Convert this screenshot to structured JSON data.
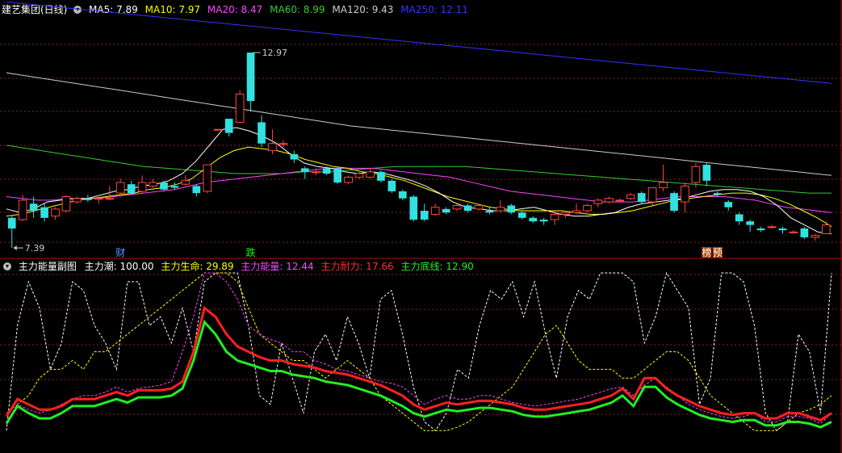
{
  "colors": {
    "up": "#ff4444",
    "down": "#33e0e0",
    "ma5": "#ffffff",
    "ma10": "#ffff00",
    "ma20": "#ff44ff",
    "ma60": "#33cc33",
    "ma120": "#cccccc",
    "ma250": "#3333ff"
  },
  "main_header": {
    "title": "建艺集团(日线)",
    "ma5": "MA5: 7.89",
    "ma10": "MA10: 7.97",
    "ma20": "MA20: 8.47",
    "ma60": "MA60: 8.99",
    "ma120": "MA120: 9.43",
    "ma250": "MA250: 12.11"
  },
  "sub_header": {
    "title": "主力能量副图",
    "l1": "主力潮: 100.00",
    "l2": "主力生命: 29.89",
    "l3": "主力能量: 12.44",
    "l4": "主力耐力: 17.66",
    "l5": "主力底线: 12.90"
  },
  "chart_data": [
    {
      "type": "candlestick",
      "title": "建艺集团(日线)",
      "ylim": [
        7.2,
        14.0
      ],
      "high_label": "12.97",
      "low_label": "7.39",
      "candles": [
        [
          8.3,
          8.0,
          8.35,
          7.45
        ],
        [
          8.25,
          8.8,
          8.95,
          8.2
        ],
        [
          8.7,
          8.5,
          8.9,
          8.3
        ],
        [
          8.6,
          8.3,
          8.7,
          8.2
        ],
        [
          8.35,
          8.55,
          8.6,
          8.25
        ],
        [
          8.5,
          8.9,
          8.95,
          8.45
        ],
        [
          8.75,
          8.85,
          8.9,
          8.7
        ],
        [
          8.85,
          8.8,
          8.95,
          8.75
        ],
        [
          8.85,
          8.85,
          8.9,
          8.7
        ],
        [
          8.85,
          8.85,
          9.2,
          8.8
        ],
        [
          9.0,
          9.3,
          9.4,
          8.9
        ],
        [
          9.25,
          9.0,
          9.35,
          8.95
        ],
        [
          9.05,
          9.3,
          9.5,
          9.0
        ],
        [
          9.2,
          9.3,
          9.4,
          9.15
        ],
        [
          9.3,
          9.1,
          9.35,
          9.05
        ],
        [
          9.2,
          9.15,
          9.3,
          9.1
        ],
        [
          9.25,
          9.35,
          9.5,
          9.2
        ],
        [
          9.2,
          9.0,
          9.25,
          8.9
        ],
        [
          9.05,
          9.8,
          9.8,
          9.0
        ],
        [
          10.8,
          10.8,
          10.8,
          10.8
        ],
        [
          11.1,
          10.7,
          11.1,
          10.6
        ],
        [
          11.0,
          11.8,
          11.9,
          11.0
        ],
        [
          12.97,
          11.6,
          12.97,
          11.3
        ],
        [
          11.0,
          10.4,
          11.2,
          10.3
        ],
        [
          10.2,
          10.4,
          10.8,
          10.1
        ],
        [
          10.4,
          10.4,
          10.5,
          10.3
        ],
        [
          10.1,
          9.95,
          10.2,
          9.85
        ],
        [
          9.7,
          9.6,
          9.75,
          9.4
        ],
        [
          9.6,
          9.6,
          9.7,
          9.5
        ],
        [
          9.7,
          9.55,
          9.75,
          9.5
        ],
        [
          9.7,
          9.3,
          9.75,
          9.25
        ],
        [
          9.3,
          9.45,
          9.5,
          9.25
        ],
        [
          9.45,
          9.55,
          9.6,
          9.4
        ],
        [
          9.45,
          9.6,
          9.7,
          9.4
        ],
        [
          9.6,
          9.35,
          9.65,
          9.3
        ],
        [
          9.35,
          9.05,
          9.4,
          9.0
        ],
        [
          9.05,
          8.85,
          9.1,
          8.8
        ],
        [
          8.9,
          8.25,
          8.95,
          8.2
        ],
        [
          8.5,
          8.25,
          8.7,
          8.2
        ],
        [
          8.4,
          8.6,
          8.7,
          8.35
        ],
        [
          8.55,
          8.45,
          8.6,
          8.4
        ],
        [
          8.55,
          8.65,
          8.7,
          8.5
        ],
        [
          8.65,
          8.5,
          8.7,
          8.45
        ],
        [
          8.55,
          8.65,
          8.7,
          8.5
        ],
        [
          8.5,
          8.45,
          8.6,
          8.4
        ],
        [
          8.5,
          8.6,
          8.8,
          8.45
        ],
        [
          8.65,
          8.45,
          8.7,
          8.4
        ],
        [
          8.45,
          8.3,
          8.5,
          8.25
        ],
        [
          8.3,
          8.2,
          8.35,
          8.15
        ],
        [
          8.25,
          8.2,
          8.3,
          8.1
        ],
        [
          8.25,
          8.4,
          8.5,
          8.1
        ],
        [
          8.4,
          8.45,
          8.5,
          8.3
        ],
        [
          8.45,
          8.5,
          8.7,
          8.4
        ],
        [
          8.5,
          8.65,
          8.7,
          8.45
        ],
        [
          8.7,
          8.8,
          8.85,
          8.6
        ],
        [
          8.75,
          8.85,
          8.9,
          8.7
        ],
        [
          8.8,
          8.8,
          8.85,
          8.75
        ],
        [
          8.85,
          8.95,
          9.0,
          8.8
        ],
        [
          9.0,
          8.75,
          9.05,
          8.7
        ],
        [
          8.75,
          9.15,
          9.15,
          8.65
        ],
        [
          9.15,
          9.3,
          9.8,
          9.05
        ],
        [
          9.0,
          8.5,
          9.05,
          8.45
        ],
        [
          8.75,
          9.2,
          9.3,
          8.45
        ],
        [
          9.3,
          9.75,
          9.85,
          9.15
        ],
        [
          9.8,
          9.35,
          9.85,
          9.2
        ],
        [
          9.0,
          8.95,
          9.05,
          8.9
        ],
        [
          8.75,
          8.6,
          8.8,
          8.5
        ],
        [
          8.4,
          8.2,
          8.45,
          8.1
        ],
        [
          8.2,
          8.1,
          8.25,
          7.9
        ],
        [
          8.0,
          7.95,
          8.05,
          7.9
        ],
        [
          8.05,
          8.05,
          8.1,
          8.0
        ],
        [
          8.0,
          7.95,
          8.05,
          7.85
        ],
        [
          7.9,
          7.9,
          7.95,
          7.85
        ],
        [
          8.0,
          7.75,
          8.05,
          7.7
        ],
        [
          7.75,
          7.8,
          7.85,
          7.65
        ],
        [
          7.85,
          8.1,
          8.2,
          7.85
        ]
      ],
      "ma5": [
        8.55,
        8.45,
        8.55,
        8.75,
        8.8,
        8.85,
        8.85,
        8.95,
        9.05,
        9.1,
        9.2,
        9.25,
        9.35,
        9.55,
        9.9,
        10.35,
        10.8,
        10.85,
        10.75,
        10.6,
        10.4,
        10.1,
        9.85,
        9.75,
        9.7,
        9.6,
        9.55,
        9.6,
        9.55,
        9.45,
        9.35,
        9.2,
        9.0,
        8.75,
        8.6,
        8.55,
        8.5,
        8.5,
        8.55,
        8.6,
        8.5,
        8.4,
        8.35,
        8.35,
        8.4,
        8.45,
        8.6,
        8.7,
        8.75,
        8.8,
        8.85,
        8.95,
        9.05,
        9.1,
        9.1,
        9.05,
        8.9,
        8.65,
        8.3,
        8.1,
        7.9,
        7.85
      ],
      "ma10": [
        8.35,
        8.4,
        8.5,
        8.6,
        8.7,
        8.8,
        8.85,
        8.9,
        8.95,
        9.0,
        9.1,
        9.15,
        9.25,
        9.4,
        9.7,
        10.0,
        10.2,
        10.3,
        10.25,
        10.2,
        10.1,
        9.95,
        9.85,
        9.75,
        9.7,
        9.6,
        9.55,
        9.45,
        9.35,
        9.2,
        9.05,
        8.9,
        8.8,
        8.7,
        8.6,
        8.55,
        8.5,
        8.5,
        8.5,
        8.5,
        8.45,
        8.4,
        8.4,
        8.45,
        8.5,
        8.6,
        8.7,
        8.8,
        8.85,
        8.9,
        8.95,
        9.0,
        9.0,
        8.95,
        8.85,
        8.7,
        8.5,
        8.3,
        8.05
      ],
      "ma20": [
        8.9,
        8.85,
        8.8,
        8.8,
        8.85,
        8.85,
        8.85,
        8.9,
        8.95,
        9.0,
        9.05,
        9.1,
        9.2,
        9.3,
        9.35,
        9.4,
        9.45,
        9.5,
        9.55,
        9.6,
        9.65,
        9.7,
        9.7,
        9.7,
        9.7,
        9.65,
        9.6,
        9.55,
        9.5,
        9.45,
        9.35,
        9.25,
        9.15,
        9.05,
        9.0,
        8.95,
        8.9,
        8.85,
        8.8,
        8.75,
        8.75,
        8.75,
        8.8,
        8.85,
        8.9,
        8.9,
        8.9,
        8.9,
        8.85,
        8.8,
        8.7,
        8.6,
        8.55,
        8.5,
        8.45
      ],
      "ma60": [
        10.35,
        10.25,
        10.15,
        10.05,
        9.95,
        9.85,
        9.75,
        9.7,
        9.65,
        9.6,
        9.55,
        9.55,
        9.55,
        9.6,
        9.6,
        9.65,
        9.7,
        9.75,
        9.75,
        9.75,
        9.75,
        9.7,
        9.65,
        9.6,
        9.55,
        9.5,
        9.45,
        9.4,
        9.35,
        9.3,
        9.25,
        9.2,
        9.15,
        9.1,
        9.05,
        9.0,
        9.0
      ],
      "ma120": [
        12.4,
        12.25,
        12.1,
        11.95,
        11.8,
        11.65,
        11.5,
        11.35,
        11.2,
        11.05,
        10.9,
        10.8,
        10.7,
        10.6,
        10.5,
        10.4,
        10.3,
        10.2,
        10.1,
        10.0,
        9.9,
        9.8,
        9.7,
        9.6,
        9.5
      ],
      "ma250": [
        14.4,
        14.3,
        14.2,
        14.1,
        14.0,
        13.9,
        13.8,
        13.7,
        13.6,
        13.5,
        13.4,
        13.3,
        13.2,
        13.1,
        13.0,
        12.9,
        12.8,
        12.7,
        12.6,
        12.5,
        12.4,
        12.3,
        12.2,
        12.1
      ],
      "markers": [
        {
          "index": 10,
          "text": "财",
          "color": "#5599ff"
        },
        {
          "index": 22,
          "text": "跌",
          "color": "#00ff00"
        },
        {
          "index": 64,
          "text": "榜",
          "color": "#ff9933"
        },
        {
          "index": 65,
          "text": "预",
          "color": "#ff9933"
        }
      ]
    },
    {
      "type": "line",
      "title": "主力能量副图",
      "ylim": [
        0,
        100
      ],
      "series": [
        {
          "name": "主力潮",
          "color": "#ffffff",
          "dashed": true,
          "values": [
            10,
            70,
            95,
            80,
            45,
            60,
            95,
            90,
            70,
            60,
            45,
            95,
            95,
            70,
            75,
            60,
            80,
            55,
            95,
            100,
            100,
            100,
            70,
            30,
            25,
            60,
            40,
            20,
            55,
            65,
            50,
            75,
            60,
            40,
            85,
            90,
            65,
            35,
            15,
            10,
            20,
            45,
            40,
            70,
            90,
            85,
            95,
            75,
            95,
            65,
            40,
            75,
            90,
            85,
            100,
            100,
            100,
            95,
            60,
            75,
            100,
            90,
            80,
            25,
            40,
            100,
            100,
            95,
            70,
            20,
            10,
            15,
            65,
            55,
            20,
            100
          ]
        },
        {
          "name": "主力生命",
          "color": "#ffff00",
          "dashed": true,
          "values": [
            15,
            25,
            30,
            40,
            45,
            45,
            50,
            45,
            55,
            55,
            60,
            65,
            70,
            75,
            80,
            85,
            90,
            95,
            100,
            100,
            100,
            95,
            80,
            65,
            60,
            55,
            50,
            50,
            45,
            40,
            45,
            50,
            45,
            40,
            30,
            25,
            20,
            15,
            10,
            10,
            10,
            12,
            15,
            20,
            25,
            30,
            35,
            45,
            55,
            65,
            70,
            60,
            50,
            45,
            45,
            45,
            40,
            40,
            45,
            50,
            55,
            55,
            50,
            40,
            30,
            25,
            20,
            15,
            10,
            10,
            10,
            15,
            20,
            22,
            25,
            30
          ]
        },
        {
          "name": "主力能量",
          "color": "#ff44ff",
          "dashed": true,
          "values": [
            20,
            25,
            22,
            20,
            22,
            25,
            28,
            30,
            30,
            32,
            35,
            32,
            34,
            35,
            36,
            38,
            55,
            75,
            100,
            100,
            95,
            85,
            70,
            65,
            62,
            60,
            55,
            55,
            50,
            48,
            45,
            44,
            42,
            40,
            38,
            37,
            35,
            30,
            25,
            28,
            30,
            28,
            28,
            30,
            30,
            28,
            26,
            25,
            24,
            25,
            26,
            27,
            28,
            30,
            32,
            34,
            35,
            30,
            36,
            40,
            35,
            30,
            25,
            22,
            20,
            18,
            17,
            18,
            20,
            15,
            15,
            18,
            18,
            17,
            14,
            20
          ]
        },
        {
          "name": "主力耐力",
          "color": "#ff2020",
          "width": 3,
          "values": [
            18,
            28,
            25,
            22,
            22,
            24,
            28,
            28,
            28,
            30,
            32,
            30,
            33,
            33,
            33,
            34,
            38,
            55,
            80,
            75,
            65,
            58,
            55,
            52,
            50,
            50,
            48,
            47,
            46,
            44,
            43,
            42,
            40,
            38,
            36,
            33,
            30,
            25,
            22,
            24,
            26,
            25,
            26,
            27,
            27,
            26,
            25,
            23,
            22,
            22,
            23,
            24,
            25,
            26,
            28,
            30,
            34,
            28,
            40,
            40,
            34,
            30,
            27,
            24,
            22,
            20,
            19,
            20,
            20,
            17,
            17,
            20,
            20,
            18,
            16,
            20
          ]
        },
        {
          "name": "主力底线",
          "color": "#22ee22",
          "width": 3,
          "values": [
            14,
            24,
            20,
            17,
            17,
            20,
            24,
            24,
            24,
            26,
            28,
            26,
            29,
            29,
            29,
            30,
            34,
            50,
            72,
            65,
            55,
            50,
            48,
            46,
            44,
            44,
            42,
            41,
            40,
            38,
            37,
            36,
            34,
            32,
            30,
            27,
            24,
            20,
            18,
            20,
            22,
            21,
            22,
            23,
            23,
            22,
            21,
            19,
            18,
            18,
            19,
            20,
            21,
            22,
            24,
            26,
            30,
            24,
            35,
            35,
            29,
            25,
            22,
            19,
            17,
            16,
            15,
            16,
            16,
            13,
            13,
            15,
            15,
            14,
            12,
            15
          ]
        }
      ]
    }
  ]
}
